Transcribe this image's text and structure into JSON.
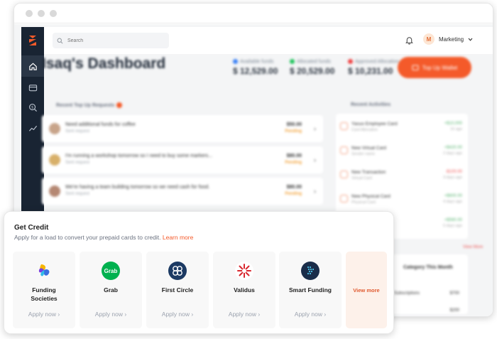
{
  "search": {
    "placeholder": "Search"
  },
  "user": {
    "initial": "M",
    "name": "Marketing"
  },
  "dashboard": {
    "title": "Isaq's Dashboard",
    "stats": [
      {
        "label": "Available funds",
        "value": "$ 12,529.00",
        "color": "#3b82f6"
      },
      {
        "label": "Allocated funds",
        "value": "$ 20,529.00",
        "color": "#22c55e"
      },
      {
        "label": "Approved Allocation",
        "value": "$ 10,231.00",
        "color": "#ef4444"
      }
    ],
    "topup_label": "Top Up Wallet",
    "requests_title": "Recent Top Up Requests",
    "requests": [
      {
        "text": "Need additional funds for coffee",
        "sub": "Sent request",
        "amount": "$50.00",
        "status": "Pending"
      },
      {
        "text": "I'm running a workshop tomorrow so I need to buy some markers...",
        "sub": "Sent request",
        "amount": "$80.00",
        "status": "Pending"
      },
      {
        "text": "We're having a team building tomorrow so we need cash for food.",
        "sub": "Sent request",
        "amount": "$80.00",
        "status": "Pending"
      }
    ],
    "activities_title": "Recent Activities",
    "activities": [
      {
        "text": "Yasuo Employee Card",
        "sub": "Card Allocation",
        "amount": "+$10,000",
        "sub2": "1h ago",
        "neg": false
      },
      {
        "text": "New Virtual Card",
        "sub": "Sender name",
        "amount": "+$420.00",
        "sub2": "2 days ago",
        "neg": false
      },
      {
        "text": "New Transaction",
        "sub": "Virtual Card",
        "amount": "-$100.00",
        "sub2": "3 days ago",
        "neg": true
      },
      {
        "text": "New Physical Card",
        "sub": "Physical Card",
        "amount": "+$600.00",
        "sub2": "4 days ago",
        "neg": false
      },
      {
        "text": "",
        "sub": "",
        "amount": "+$560.00",
        "sub2": "5 days ago",
        "neg": false
      }
    ],
    "view_all": "View More",
    "category_title": "Category This Month",
    "category_item": "Subscriptions",
    "category_amount": "$700",
    "category_amount2": "$200"
  },
  "credit": {
    "title": "Get Credit",
    "description": "Apply for a load to convert your prepaid cards to credit.",
    "learn_more": "Learn more",
    "lenders": [
      {
        "name": "Funding Societies",
        "apply": "Apply now",
        "icon": "funding-societies-logo"
      },
      {
        "name": "Grab",
        "apply": "Apply now",
        "icon": "grab-logo",
        "logo_text": "Grab"
      },
      {
        "name": "First Circle",
        "apply": "Apply now",
        "icon": "first-circle-logo"
      },
      {
        "name": "Validus",
        "apply": "Apply now",
        "icon": "validus-logo"
      },
      {
        "name": "Smart Funding",
        "apply": "Apply now",
        "icon": "smart-funding-logo"
      }
    ],
    "view_more": "View more"
  },
  "colors": {
    "accent": "#f45a2a",
    "sidebar": "#192433",
    "grab_green": "#00b14f",
    "first_circle_navy": "#1c3a63",
    "validus_red": "#d8272e"
  }
}
